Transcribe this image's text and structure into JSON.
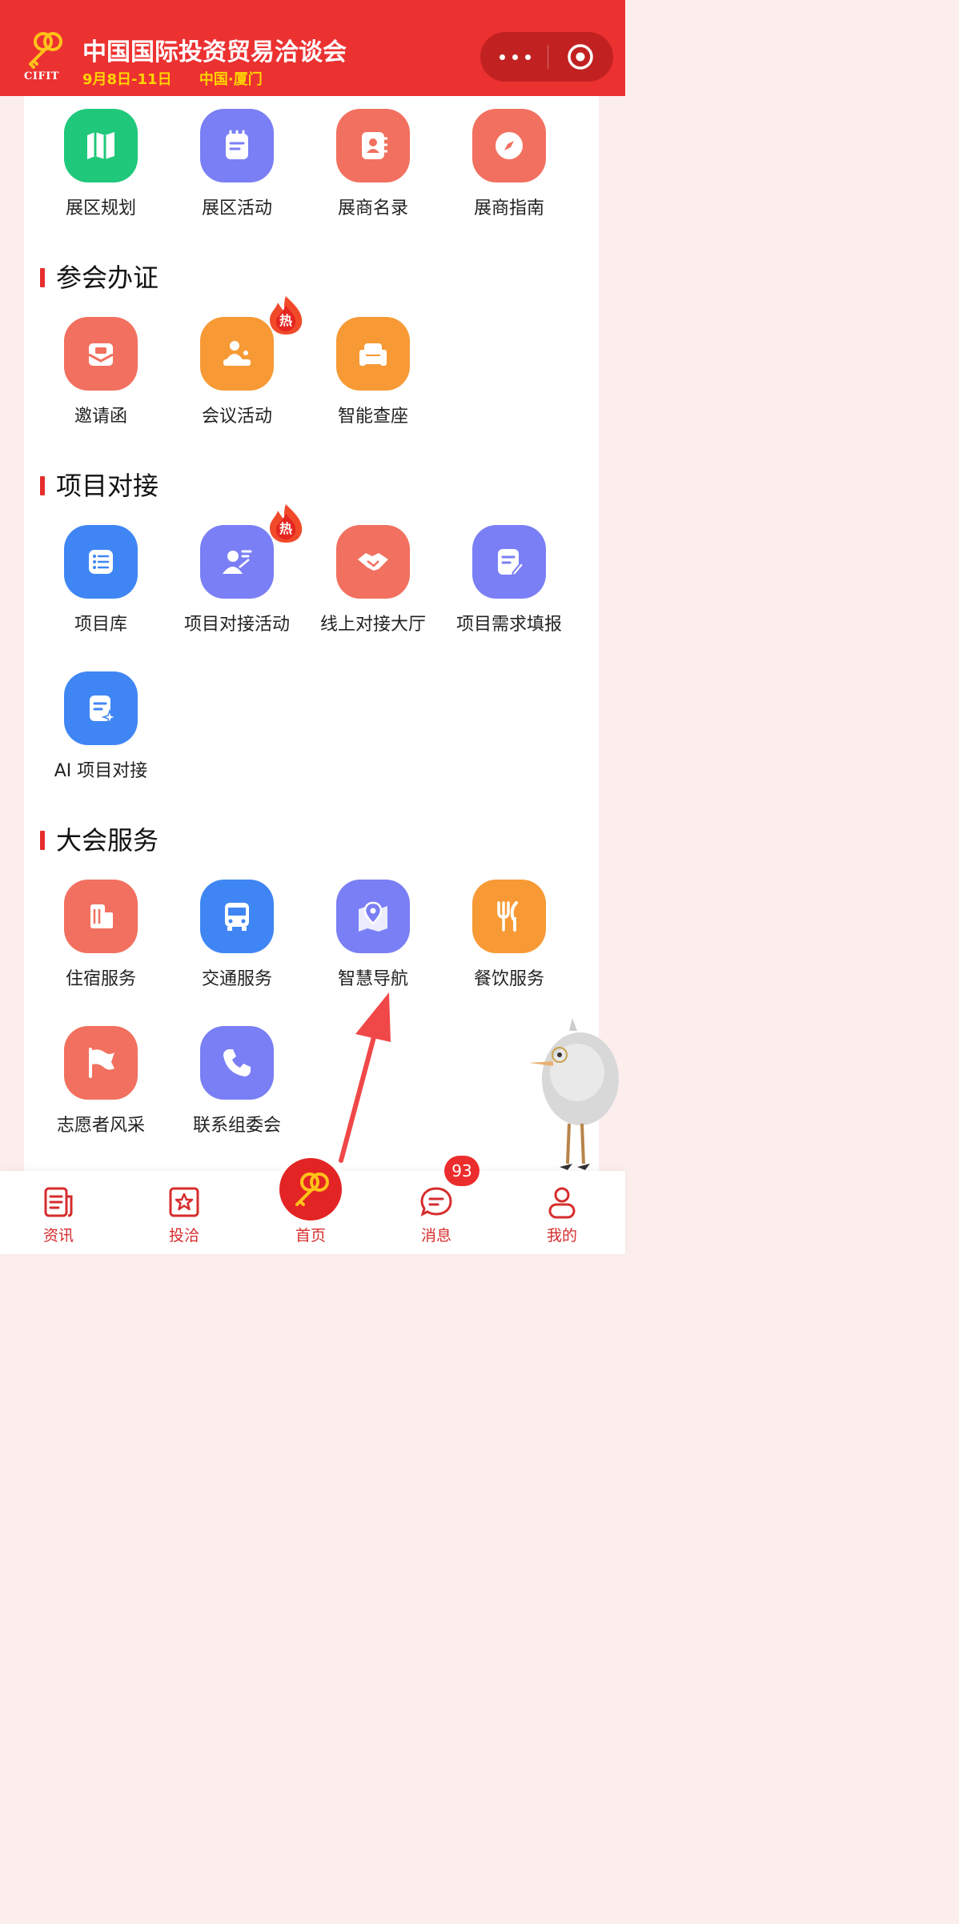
{
  "header": {
    "logo_text": "CIFIT",
    "title": "中国国际投资贸易洽谈会",
    "dates": "9月8日-11日",
    "location": "中国·厦门"
  },
  "top_row": [
    {
      "label": "展区规划",
      "icon": "map-icon",
      "color": "#1fc87a"
    },
    {
      "label": "展区活动",
      "icon": "notebook-icon",
      "color": "#7a7ff5"
    },
    {
      "label": "展商名录",
      "icon": "contacts-book-icon",
      "color": "#f2705f"
    },
    {
      "label": "展商指南",
      "icon": "compass-icon",
      "color": "#f2705f"
    }
  ],
  "sections": [
    {
      "title": "参会办证",
      "items": [
        {
          "label": "邀请函",
          "icon": "envelope-icon",
          "color": "#f2705f"
        },
        {
          "label": "会议活动",
          "icon": "speaker-podium-icon",
          "color": "#f79a35",
          "hot": "热"
        },
        {
          "label": "智能查座",
          "icon": "sofa-icon",
          "color": "#f79a35"
        }
      ]
    },
    {
      "title": "项目对接",
      "items": [
        {
          "label": "项目库",
          "icon": "list-icon",
          "color": "#3f86f4"
        },
        {
          "label": "项目对接活动",
          "icon": "presenter-icon",
          "color": "#7a7ff5",
          "hot": "热"
        },
        {
          "label": "线上对接大厅",
          "icon": "handshake-icon",
          "color": "#f2705f"
        },
        {
          "label": "项目需求填报",
          "icon": "edit-form-icon",
          "color": "#7a7ff5"
        },
        {
          "label": "AI 项目对接",
          "icon": "ai-document-icon",
          "color": "#3f86f4"
        }
      ]
    },
    {
      "title": "大会服务",
      "items": [
        {
          "label": "住宿服务",
          "icon": "building-icon",
          "color": "#f2705f"
        },
        {
          "label": "交通服务",
          "icon": "bus-icon",
          "color": "#3f86f4"
        },
        {
          "label": "智慧导航",
          "icon": "map-pin-icon",
          "color": "#7a7ff5"
        },
        {
          "label": "餐饮服务",
          "icon": "fork-knife-icon",
          "color": "#f79a35"
        },
        {
          "label": "志愿者风采",
          "icon": "flag-icon",
          "color": "#f2705f"
        },
        {
          "label": "联系组委会",
          "icon": "phone-icon",
          "color": "#7a7ff5"
        }
      ]
    }
  ],
  "nav": {
    "items": [
      {
        "label": "资讯",
        "icon": "news-icon"
      },
      {
        "label": "投洽",
        "icon": "star-badge-icon"
      },
      {
        "label": "首页",
        "icon": "home-logo-icon"
      },
      {
        "label": "消息",
        "icon": "message-icon"
      },
      {
        "label": "我的",
        "icon": "person-icon"
      }
    ],
    "message_badge": "93",
    "active_color": "#d62c2c"
  }
}
